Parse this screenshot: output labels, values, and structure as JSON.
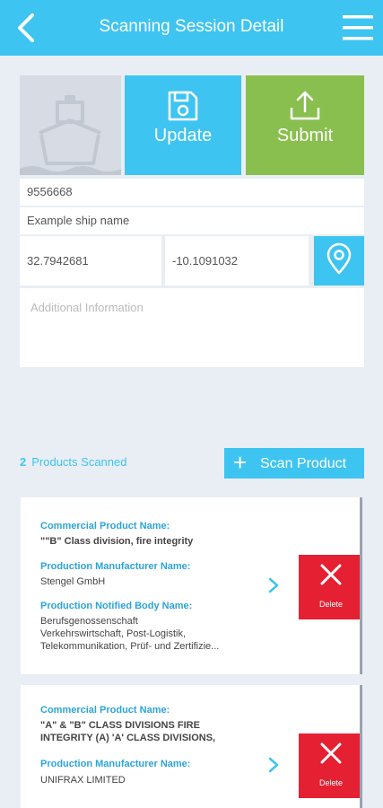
{
  "header": {
    "title": "Scanning Session Detail"
  },
  "actions": {
    "update_label": "Update",
    "submit_label": "Submit"
  },
  "form": {
    "imo": "9556668",
    "ship_name": "Example ship name",
    "latitude": "32.7942681",
    "longitude": "-10.1091032",
    "info_placeholder": "Additional Information"
  },
  "products": {
    "count": "2",
    "count_label": "Products Scanned",
    "scan_label": "Scan Product",
    "items": [
      {
        "name_label": "Commercial Product Name:",
        "name": "\"\"B\" Class division, fire integrity",
        "manufacturer_label": "Production Manufacturer Name:",
        "manufacturer": "Stengel GmbH",
        "body_label": "Production Notified Body Name:",
        "body_lines": [
          "Berufsgenossenschaft",
          "Verkehrswirtschaft, Post-Logistik,",
          "Telekommunikation, Prüf- und Zertifizie..."
        ],
        "delete_label": "Delete"
      },
      {
        "name_label": "Commercial Product Name:",
        "name_lines": [
          "\"A\" & \"B\" CLASS DIVISIONS FIRE",
          "INTEGRITY (A) 'A' CLASS DIVISIONS,"
        ],
        "manufacturer_label": "Production Manufacturer Name:",
        "manufacturer": "UNIFRAX LIMITED",
        "delete_label": "Delete"
      }
    ]
  },
  "colors": {
    "accent": "#3ec4f1",
    "submit": "#89bf4e",
    "delete": "#e52032",
    "background": "#e9eef4"
  }
}
